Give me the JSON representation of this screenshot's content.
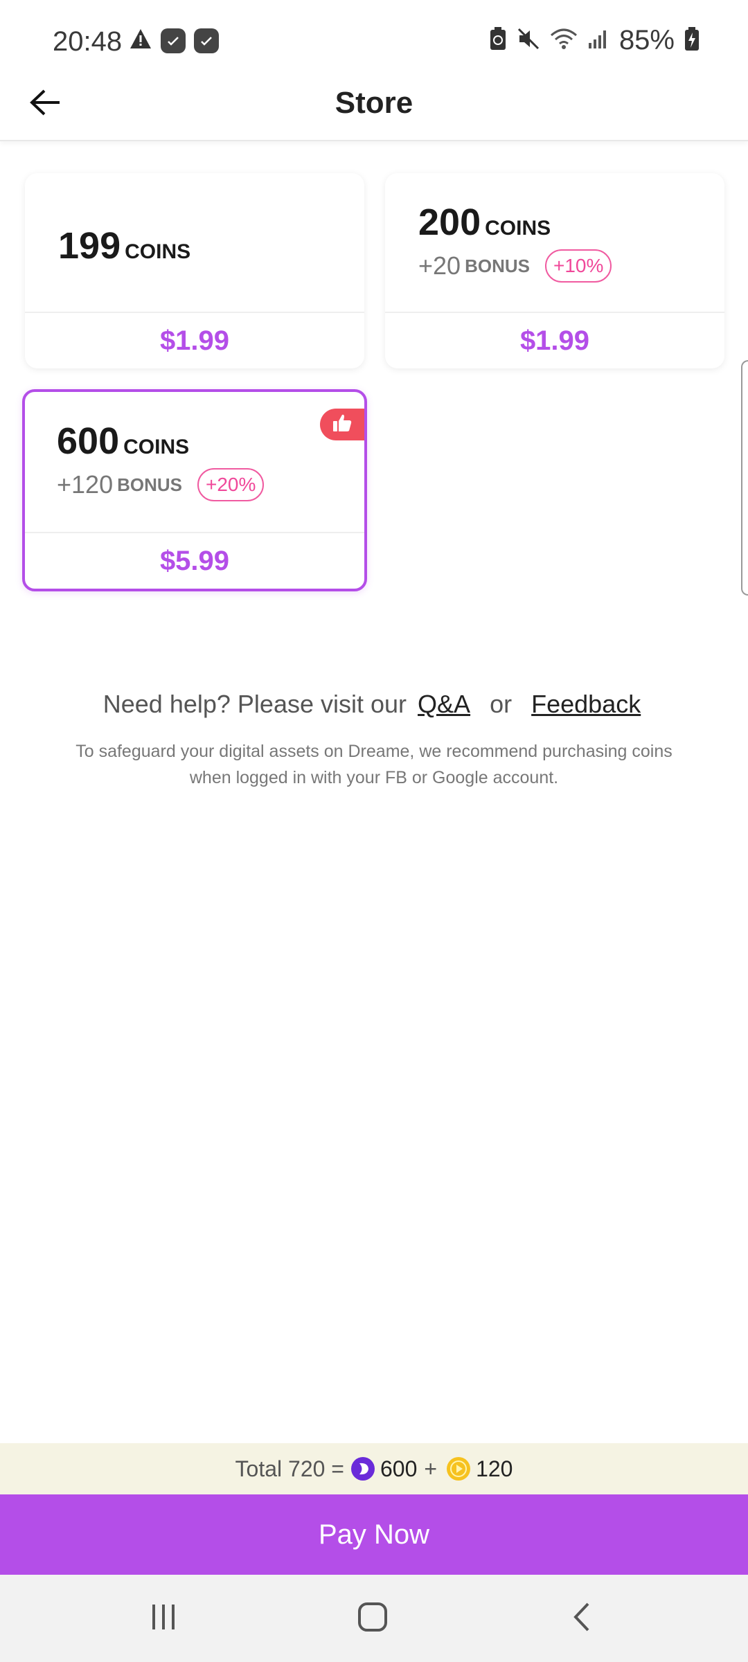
{
  "status_bar": {
    "time": "20:48",
    "battery": "85%",
    "icons": [
      "warning-icon",
      "app-icon",
      "app-icon",
      "battery-saver-icon",
      "mute-icon",
      "wifi-icon",
      "signal-icon",
      "battery-charging-icon"
    ]
  },
  "header": {
    "title": "Store",
    "back_icon": "arrow-left-icon"
  },
  "packages": [
    {
      "coins": "199",
      "unit": "COINS",
      "bonus": "",
      "bonus_unit": "",
      "bonus_pct": "",
      "price": "$1.99",
      "selected": false
    },
    {
      "coins": "200",
      "unit": "COINS",
      "bonus": "+20",
      "bonus_unit": "BONUS",
      "bonus_pct": "+10%",
      "price": "$1.99",
      "selected": false
    },
    {
      "coins": "600",
      "unit": "COINS",
      "bonus": "+120",
      "bonus_unit": "BONUS",
      "bonus_pct": "+20%",
      "price": "$5.99",
      "selected": true,
      "badge_icon": "thumbs-up-icon"
    }
  ],
  "help": {
    "prefix": "Need help? Please visit our",
    "qa_link": "Q&A",
    "or": "or",
    "feedback_link": "Feedback",
    "safeguard": "To safeguard your digital assets on Dreame, we recommend purchasing coins when logged in with your FB or Google account."
  },
  "total": {
    "label": "Total 720 =",
    "coins": "600",
    "plus": "+",
    "bonus": "120"
  },
  "pay_button": "Pay Now",
  "colors": {
    "accent": "#b44ee8",
    "bonus_pink": "#f0489a",
    "badge_red": "#f04e5c",
    "total_bg": "#f5f3e3"
  }
}
